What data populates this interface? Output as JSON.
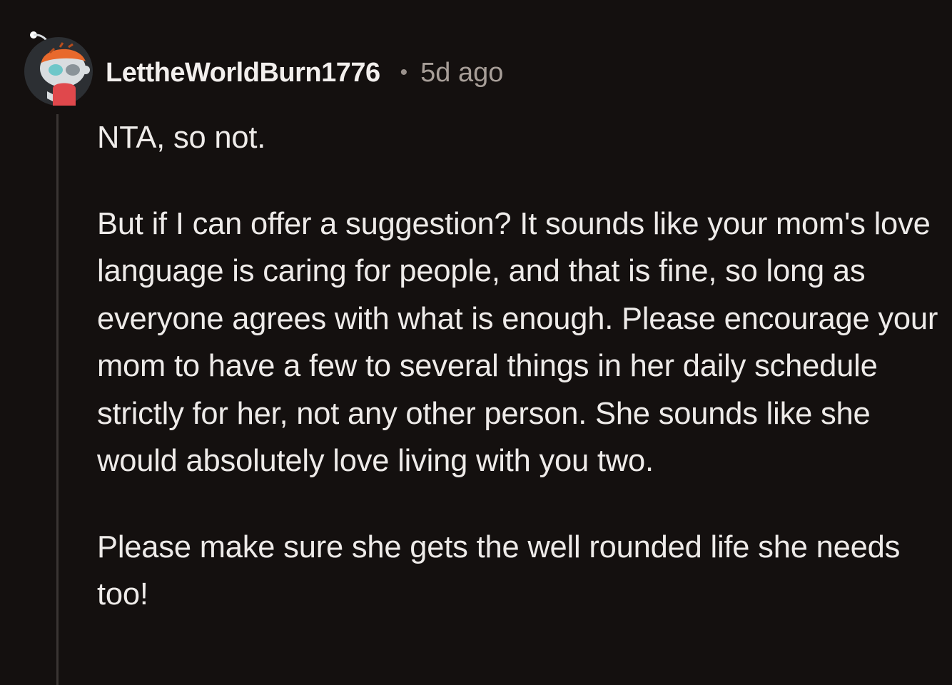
{
  "comment": {
    "author": "LettheWorldBurn1776",
    "separator": "•",
    "timestamp": "5d ago",
    "paragraphs": [
      "NTA, so not.",
      "But if I can offer a suggestion? It sounds like your mom's love language is caring for people, and that is fine, so long as everyone agrees with what is enough. Please encourage your mom to have a few to several things in her daily schedule strictly for her, not any other person. She sounds like she would absolutely love living with you two.",
      "Please make sure she gets the well rounded life she needs too!"
    ]
  },
  "avatar": {
    "icon": "snoo-avatar-icon",
    "colors": {
      "background": "#2c2f33",
      "helmet": "#e8692c",
      "face": "#d9dde0",
      "shirt": "#e0484c"
    }
  },
  "colors": {
    "page_background": "#14100f",
    "text": "#eeebe9",
    "muted": "#a79e98",
    "thread_line": "#3a3533"
  }
}
